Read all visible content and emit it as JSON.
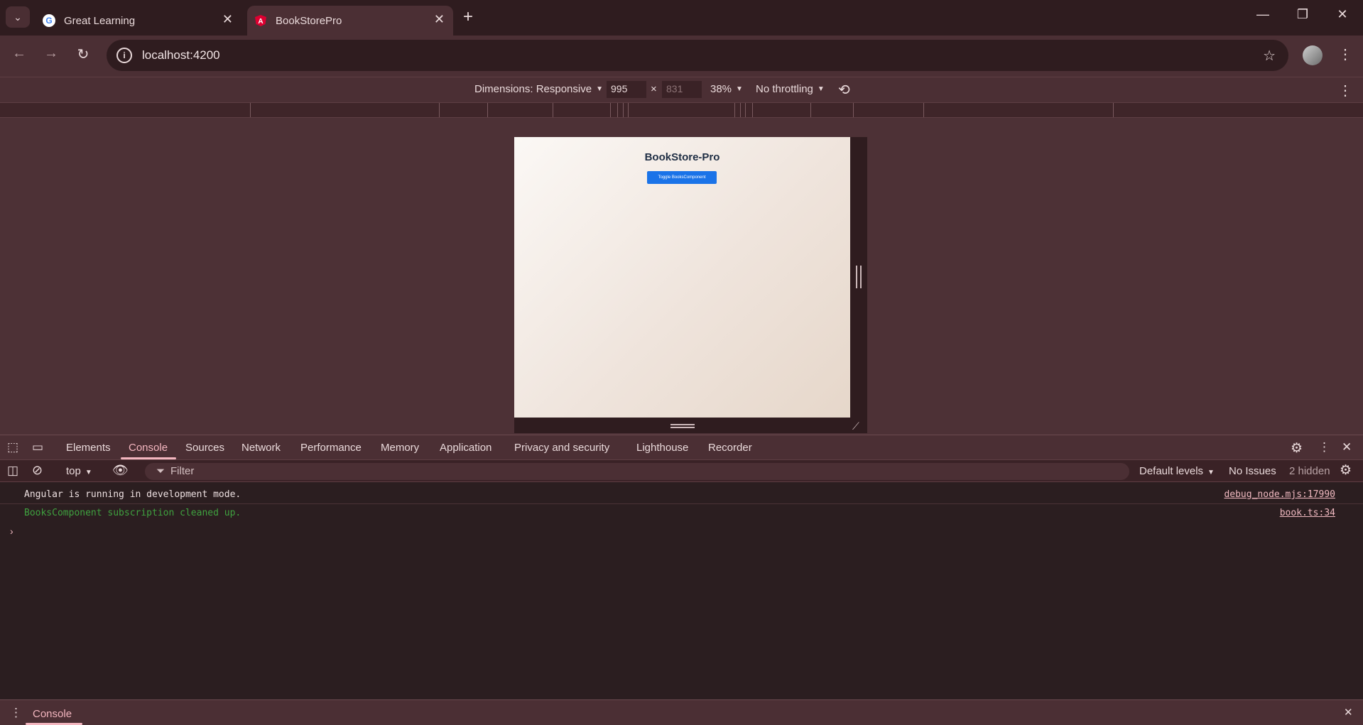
{
  "browser": {
    "tabs": [
      {
        "title": "Great Learning"
      },
      {
        "title": "BookStorePro"
      }
    ],
    "url": "localhost:4200"
  },
  "device_toolbar": {
    "dimensions_label": "Dimensions: Responsive",
    "width": "995",
    "height": "831",
    "zoom": "38%",
    "throttling": "No throttling"
  },
  "page": {
    "title": "BookStore-Pro",
    "toggle_button": "Toggle BooksComponent"
  },
  "devtools": {
    "tabs": [
      "Elements",
      "Console",
      "Sources",
      "Network",
      "Performance",
      "Memory",
      "Application",
      "Privacy and security",
      "Lighthouse",
      "Recorder"
    ],
    "active_tab": "Console",
    "context": "top",
    "filter_placeholder": "Filter",
    "levels": "Default levels",
    "issues": "No Issues",
    "hidden": "2 hidden",
    "logs": [
      {
        "text": "Angular is running in development mode.",
        "source": "debug_node.mjs:17990"
      },
      {
        "text": "BooksComponent subscription cleaned up.",
        "source": "book.ts:34"
      }
    ],
    "drawer_tab": "Console"
  },
  "colors": {
    "accent": "#f3b6bf",
    "log_green": "#3fa13f",
    "primary_button": "#1a73e8"
  }
}
